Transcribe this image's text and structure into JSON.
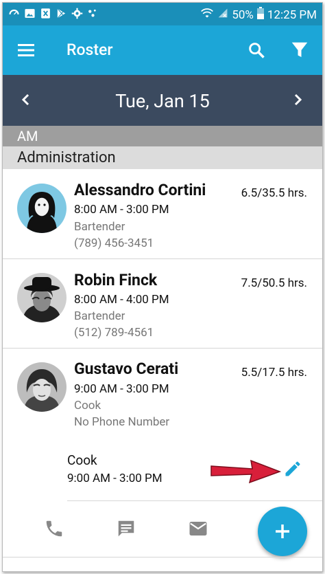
{
  "status_bar": {
    "battery": "50%",
    "clock": "12:25 PM"
  },
  "app_bar": {
    "title": "Roster"
  },
  "date_nav": {
    "date": "Tue, Jan 15"
  },
  "shift": {
    "label": "AM"
  },
  "department": {
    "label": "Administration"
  },
  "employees": [
    {
      "name": "Alessandro Cortini",
      "time": "8:00 AM - 3:00 PM",
      "role": "Bartender",
      "phone": "(789) 456-3451",
      "hours": "6.5/35.5 hrs."
    },
    {
      "name": "Robin Finck",
      "time": "8:00 AM - 4:00 PM",
      "role": "Bartender",
      "phone": "(512) 789-4561",
      "hours": "7.5/50.5 hrs."
    },
    {
      "name": "Gustavo Cerati",
      "time": "9:00 AM - 3:00 PM",
      "role": "Cook",
      "phone": "No Phone Number",
      "hours": "5.5/17.5 hrs."
    }
  ],
  "expanded_shift": {
    "role": "Cook",
    "time": "9:00 AM - 3:00 PM"
  },
  "actions": {
    "icons": [
      "phone-icon",
      "message-icon",
      "email-icon",
      "add-icon"
    ]
  },
  "colors": {
    "status_bar": "#1a8fb9",
    "app_bar": "#1ca6d7",
    "date_bar": "#3b4a5f",
    "shift_header": "#9e9e9e",
    "dept_header": "#dcdcdc",
    "annotation_arrow": "#d81f3a"
  }
}
